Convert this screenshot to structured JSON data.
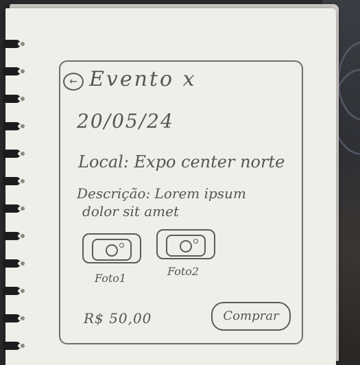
{
  "sketch": {
    "back_icon": "←",
    "title": "Evento x",
    "date": "20/05/24",
    "local": "Local: Expo center norte",
    "description_line1": "Descrição: Lorem ipsum",
    "description_line2": "dolor sit amet",
    "photos": [
      {
        "label": "Foto1",
        "icon": "camera-icon"
      },
      {
        "label": "Foto2",
        "icon": "camera-icon"
      }
    ],
    "price": "R$ 50,00",
    "buy_label": "Comprar"
  },
  "colors": {
    "paper": "#efeee9",
    "ink": "#555555",
    "background": "#2a2a2c"
  }
}
